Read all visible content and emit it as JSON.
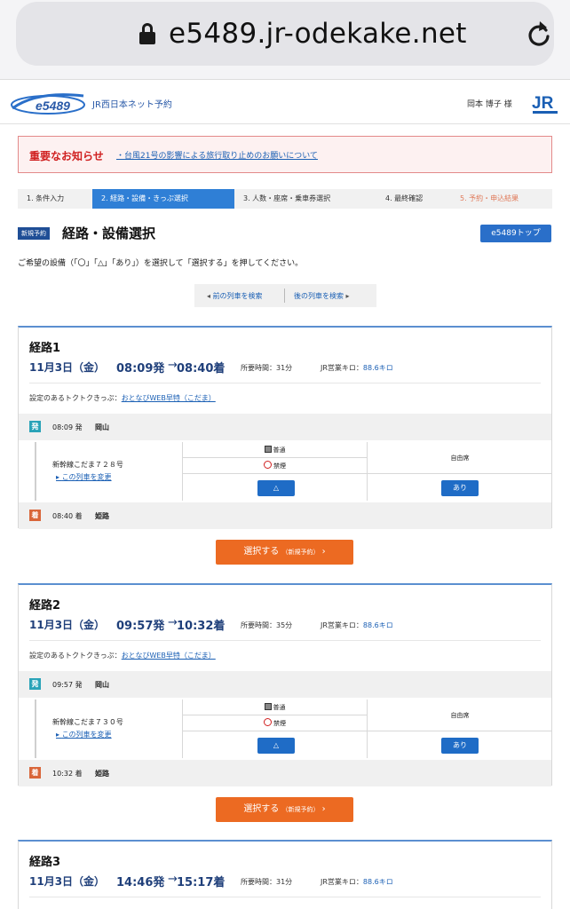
{
  "browser": {
    "url": "e5489.jr-odekake.net"
  },
  "header": {
    "logo_text": "e5489",
    "brand": "JR西日本ネット予約",
    "user": "岡本 博子 様",
    "jr_logo": "JR"
  },
  "notice": {
    "title": "重要なお知らせ",
    "link": "台風21号の影響による旅行取り止めのお願いについて"
  },
  "steps": [
    {
      "label": "1. 条件入力"
    },
    {
      "label": "2. 経路・設備・きっぷ選択"
    },
    {
      "label": "3. 人数・座席・乗車券選択"
    },
    {
      "label": "4. 最終確認"
    },
    {
      "label": "5. 予約・申込結果"
    }
  ],
  "title": {
    "badge": "新規予約",
    "text": "経路・設備選択",
    "top_button": "e5489トップ"
  },
  "instruction": "ご希望の設備（「〇」「△」「あり」）を選択して「選択する」を押してください。",
  "pager": {
    "prev": "前の列車を検索",
    "next": "後の列車を検索"
  },
  "labels": {
    "duration_prefix": "所要時間：",
    "km_prefix": "JR営業キロ：",
    "ticket_prefix": "設定のあるトクトクきっぷ：",
    "dep_suffix": "発",
    "arr_suffix": "着",
    "ordinary": "普通",
    "no_smoking": "禁煙",
    "non_reserved": "自由席",
    "change_train": "この列車を変更",
    "select_main": "選択する",
    "select_sub": "（新規予約）"
  },
  "routes": [
    {
      "name": "経路1",
      "date": "11月3日（金）",
      "dep_time": "08:09",
      "arr_time": "08:40",
      "duration": "31分",
      "km": "88.6キロ",
      "ticket": "おとなびWEB早特（こだま）",
      "dep_station_time": "08:09 発",
      "dep_station": "岡山",
      "train": "新幹線こだま７２８号",
      "reserved_mark": "△",
      "free_mark": "あり",
      "arr_station_time": "08:40 着",
      "arr_station": "姫路"
    },
    {
      "name": "経路2",
      "date": "11月3日（金）",
      "dep_time": "09:57",
      "arr_time": "10:32",
      "duration": "35分",
      "km": "88.6キロ",
      "ticket": "おとなびWEB早特（こだま）",
      "dep_station_time": "09:57 発",
      "dep_station": "岡山",
      "train": "新幹線こだま７３０号",
      "reserved_mark": "△",
      "free_mark": "あり",
      "arr_station_time": "10:32 着",
      "arr_station": "姫路"
    },
    {
      "name": "経路3",
      "date": "11月3日（金）",
      "dep_time": "14:46",
      "arr_time": "15:17",
      "duration": "31分",
      "km": "88.6キロ"
    }
  ],
  "colors": {
    "accent_blue": "#2f7fd6",
    "select_orange": "#ec6a22",
    "notice_red": "#d02020"
  }
}
